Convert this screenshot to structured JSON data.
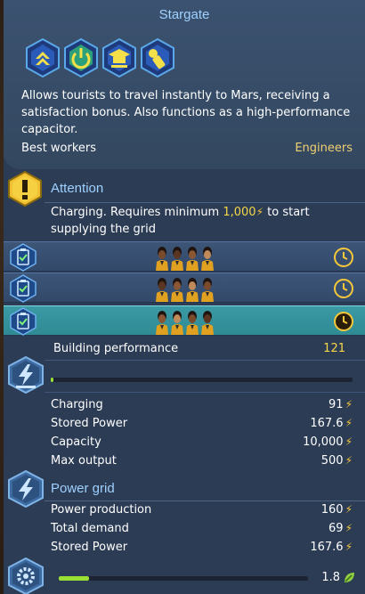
{
  "header": {
    "title": "Stargate",
    "skills": [
      "upgrade-arrows-icon",
      "power-icon",
      "graduation-cap-icon",
      "pill-bottle-icon"
    ],
    "description": "Allows tourists to travel instantly to Mars, receiving a satisfaction bonus. Also functions as a high-performance capacitor.",
    "best_workers_label": "Best workers",
    "best_workers_value": "Engineers"
  },
  "attention": {
    "title": "Attention",
    "text_before": "Charging. Requires minimum ",
    "amount": "1,000",
    "text_after": " to start supplying the grid"
  },
  "shifts": [
    {
      "active": false,
      "workers": 4
    },
    {
      "active": false,
      "workers": 4
    },
    {
      "active": true,
      "workers": 4
    }
  ],
  "performance": {
    "label": "Building performance",
    "value": "121"
  },
  "power": {
    "progress": 0.01,
    "rows": [
      {
        "label": "Charging",
        "value": "91"
      },
      {
        "label": "Stored Power",
        "value": "167.6"
      },
      {
        "label": "Capacity",
        "value": "10,000"
      },
      {
        "label": "Max output",
        "value": "500"
      }
    ]
  },
  "grid": {
    "title": "Power grid",
    "rows": [
      {
        "label": "Power production",
        "value": "160"
      },
      {
        "label": "Total demand",
        "value": "69"
      },
      {
        "label": "Stored Power",
        "value": "167.6"
      }
    ]
  },
  "maintenance": {
    "progress": 0.12,
    "value": "1.8"
  },
  "colors": {
    "accent": "#9fd1ff",
    "highlight": "#f5d847",
    "bar": "#9ae035",
    "active_shift": "#3b9aa5"
  }
}
